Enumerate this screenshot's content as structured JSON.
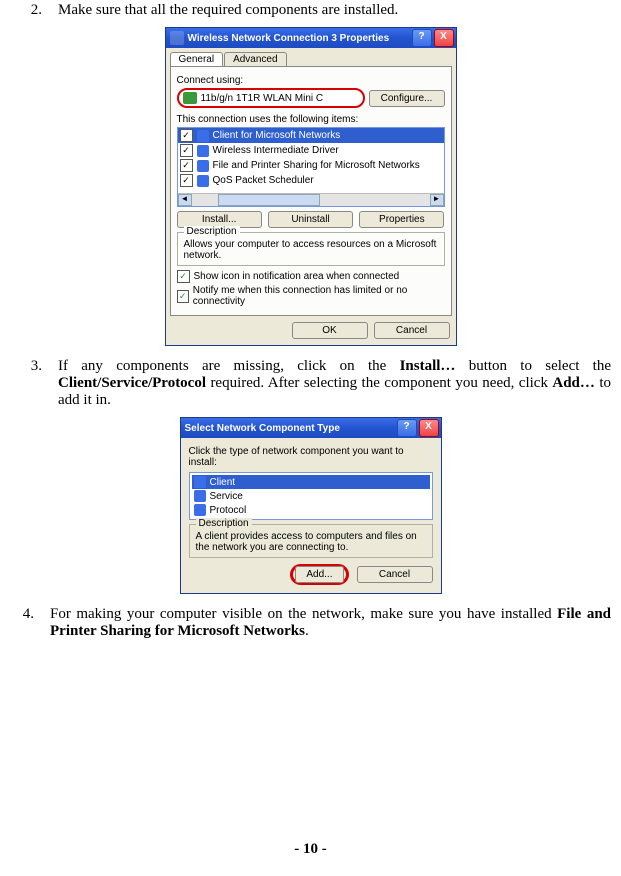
{
  "steps": {
    "s2": {
      "num": "2.",
      "text": "Make sure that all the required components are installed."
    },
    "s3": {
      "num": "3.",
      "pre": "If any components are missing, click on the ",
      "bold1": "Install…",
      "mid1": " button to select the ",
      "bold2": "Client/Service/Protocol",
      "mid2": " required. After selecting the component you need, click ",
      "bold3": "Add…",
      "post": " to add it in."
    },
    "s4": {
      "num": "4.",
      "pre": "For making your computer visible on the network, make sure you have installed ",
      "bold1": "File and Printer Sharing for Microsoft Networks",
      "post": "."
    }
  },
  "dlg1": {
    "title": "Wireless Network Connection 3 Properties",
    "tab_general": "General",
    "tab_advanced": "Advanced",
    "connect_using": "Connect using:",
    "adapter": "11b/g/n 1T1R WLAN Mini C",
    "configure": "Configure...",
    "uses_items": "This connection uses the following items:",
    "items": [
      "Client for Microsoft Networks",
      "Wireless Intermediate Driver",
      "File and Printer Sharing for Microsoft Networks",
      "QoS Packet Scheduler"
    ],
    "install": "Install...",
    "uninstall": "Uninstall",
    "properties": "Properties",
    "desc_label": "Description",
    "desc_text": "Allows your computer to access resources on a Microsoft network.",
    "show_icon": "Show icon in notification area when connected",
    "notify": "Notify me when this connection has limited or no connectivity",
    "ok": "OK",
    "cancel": "Cancel"
  },
  "dlg2": {
    "title": "Select Network Component Type",
    "instruction": "Click the type of network component you want to install:",
    "types": [
      "Client",
      "Service",
      "Protocol"
    ],
    "desc_label": "Description",
    "desc_text": "A client provides access to computers and files on the network you are connecting to.",
    "add": "Add...",
    "cancel": "Cancel"
  },
  "page_num": "- 10 -"
}
